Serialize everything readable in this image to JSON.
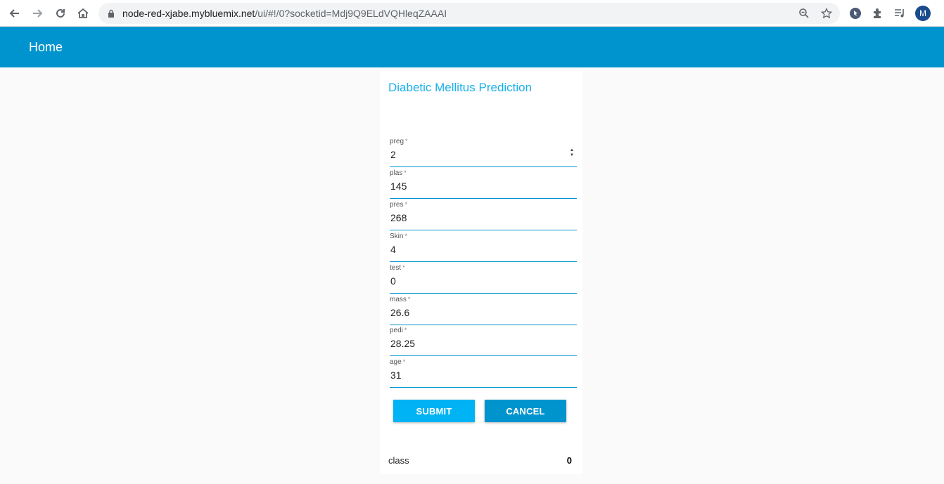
{
  "browser": {
    "url_host": "node-red-xjabe.mybluemix.net",
    "url_path": "/ui/#!/0?socketid=Mdj9Q9ELdVQHleqZAAAI",
    "avatar_letter": "M"
  },
  "app": {
    "title": "Home",
    "accent_color": "#0094ce"
  },
  "form": {
    "title": "Diabetic Mellitus Prediction",
    "required_mark": "*",
    "fields": [
      {
        "label": "preg",
        "value": "2"
      },
      {
        "label": "plas",
        "value": "145"
      },
      {
        "label": "pres",
        "value": "268"
      },
      {
        "label": "Skin",
        "value": "4"
      },
      {
        "label": "test",
        "value": "0"
      },
      {
        "label": "mass",
        "value": "26.6"
      },
      {
        "label": "pedi",
        "value": "28.25"
      },
      {
        "label": "age",
        "value": "31"
      }
    ],
    "submit_label": "SUBMIT",
    "cancel_label": "CANCEL"
  },
  "result": {
    "label": "class",
    "value": "0"
  }
}
